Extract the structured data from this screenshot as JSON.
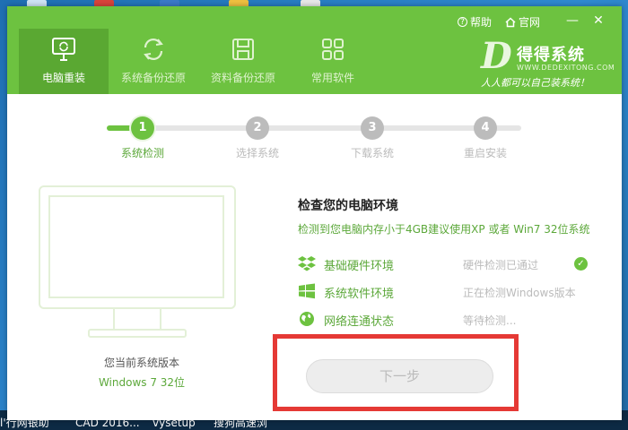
{
  "header": {
    "help": "帮助",
    "official_site": "官网",
    "tabs": [
      {
        "label": "电脑重装",
        "icon": "monitor-refresh-icon",
        "active": true
      },
      {
        "label": "系统备份还原",
        "icon": "refresh-icon",
        "active": false
      },
      {
        "label": "资料备份还原",
        "icon": "save-icon",
        "active": false
      },
      {
        "label": "常用软件",
        "icon": "grid-icon",
        "active": false
      }
    ],
    "logo": {
      "title": "得得系统",
      "sub": "WWW.DEDEXITONG.COM",
      "slogan": "人人都可以自己装系统！"
    }
  },
  "steps": [
    {
      "num": "1",
      "label": "系统检测",
      "state": "done"
    },
    {
      "num": "2",
      "label": "选择系统",
      "state": "todo"
    },
    {
      "num": "3",
      "label": "下载系统",
      "state": "todo"
    },
    {
      "num": "4",
      "label": "重启安装",
      "state": "todo"
    }
  ],
  "current_system": {
    "label": "您当前系统版本",
    "value": "Windows 7 32位"
  },
  "check": {
    "title": "检查您的电脑环境",
    "desc": "检测到您电脑内存小于4GB建议使用XP 或者 Win7 32位系统",
    "rows": [
      {
        "name": "基础硬件环境",
        "status": "硬件检测已通过",
        "icon": "dropbox-icon",
        "ok": true
      },
      {
        "name": "系统软件环境",
        "status": "正在检测Windows版本",
        "icon": "windows-icon",
        "ok": false
      },
      {
        "name": "网络连通状态",
        "status": "等待检测...",
        "icon": "globe-icon",
        "ok": false
      }
    ]
  },
  "next_button": "下一步",
  "taskbar": {
    "items": [
      "l'行网银助",
      "CAD 2016...",
      "vysetup",
      "搜狗高速浏"
    ]
  },
  "colors": {
    "brand_green": "#6dc240",
    "highlight_red": "#e53935"
  }
}
